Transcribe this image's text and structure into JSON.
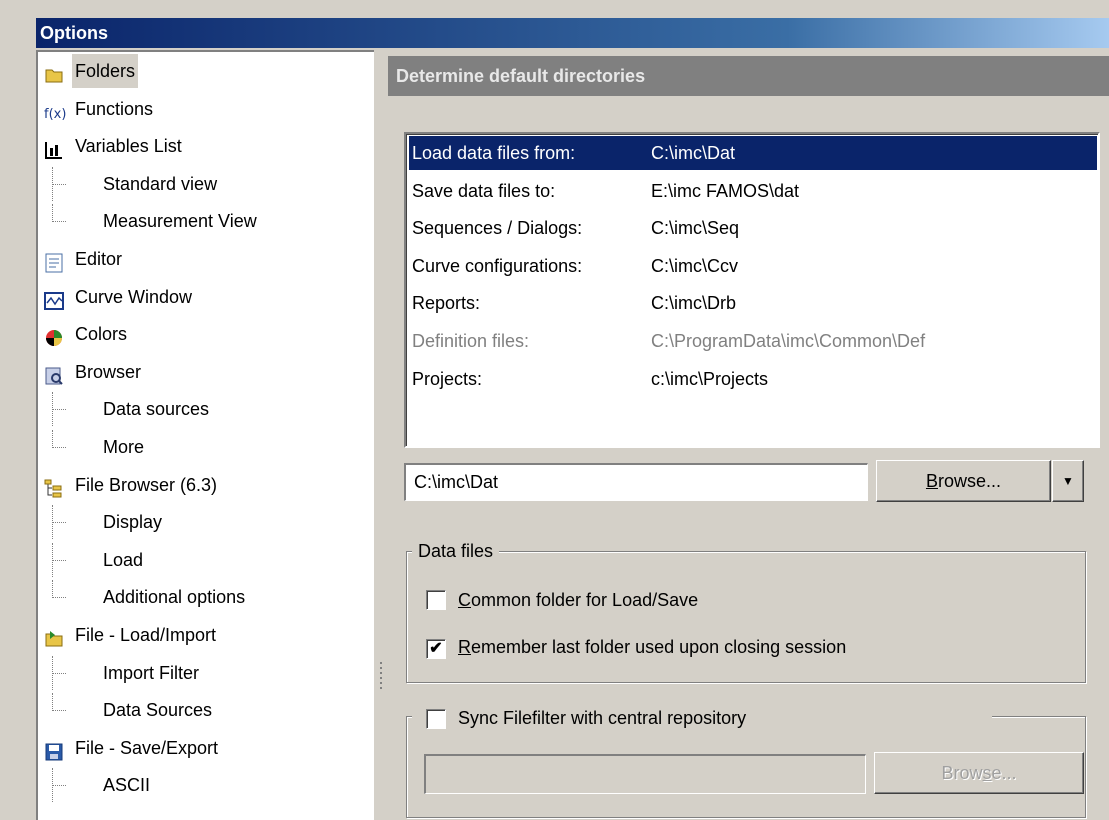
{
  "window": {
    "title": "Options"
  },
  "tree": {
    "items": [
      {
        "label": "Folders",
        "icon": "folder-icon",
        "selected": true
      },
      {
        "label": "Functions",
        "icon": "function-icon"
      },
      {
        "label": "Variables List",
        "icon": "variables-list-icon"
      },
      {
        "label": "Standard view",
        "child": true
      },
      {
        "label": "Measurement View",
        "child": true,
        "last": true
      },
      {
        "label": "Editor",
        "icon": "editor-icon"
      },
      {
        "label": "Curve Window",
        "icon": "curve-window-icon"
      },
      {
        "label": "Colors",
        "icon": "colors-icon"
      },
      {
        "label": "Browser",
        "icon": "browser-icon"
      },
      {
        "label": "Data sources",
        "child": true
      },
      {
        "label": "More",
        "child": true,
        "last": true
      },
      {
        "label": "File Browser (6.3)",
        "icon": "file-browser-icon"
      },
      {
        "label": "Display",
        "child": true
      },
      {
        "label": "Load",
        "child": true
      },
      {
        "label": "Additional options",
        "child": true,
        "last": true
      },
      {
        "label": "File - Load/Import",
        "icon": "file-load-icon"
      },
      {
        "label": "Import Filter",
        "child": true
      },
      {
        "label": "Data Sources",
        "child": true,
        "last": true
      },
      {
        "label": "File - Save/Export",
        "icon": "save-disk-icon"
      },
      {
        "label": "ASCII",
        "child": true
      }
    ]
  },
  "panel": {
    "header": "Determine default directories",
    "directories": [
      {
        "label": "Load data files from:",
        "path": "C:\\imc\\Dat",
        "selected": true
      },
      {
        "label": "Save data files to:",
        "path": "E:\\imc FAMOS\\dat"
      },
      {
        "label": "Sequences / Dialogs:",
        "path": "C:\\imc\\Seq"
      },
      {
        "label": "Curve configurations:",
        "path": "C:\\imc\\Ccv"
      },
      {
        "label": "Reports:",
        "path": "C:\\imc\\Drb"
      },
      {
        "label": "Definition files:",
        "path": "C:\\ProgramData\\imc\\Common\\Def",
        "disabled": true
      },
      {
        "label": "Projects:",
        "path": "c:\\imc\\Projects"
      }
    ],
    "path_value": "C:\\imc\\Dat",
    "browse_label_pre": "",
    "browse_label_u": "B",
    "browse_label_post": "rowse...",
    "dropdown_arrow": "▼",
    "data_files_group": {
      "legend": "Data files",
      "common_folder": {
        "u": "C",
        "rest": "ommon folder for Load/Save",
        "checked": false
      },
      "remember_last": {
        "u": "R",
        "rest": "emember last folder used upon closing session",
        "checked": true
      }
    },
    "sync_group": {
      "label": "Sync Filefilter with central repository",
      "checked": false,
      "browse_pre": "Brow",
      "browse_u": "s",
      "browse_post": "e..."
    },
    "check_mark": "✔"
  },
  "colors": {
    "selection": "#0a246a",
    "title_gradient_start": "#0a246a",
    "panel_header_bg": "#808080"
  }
}
